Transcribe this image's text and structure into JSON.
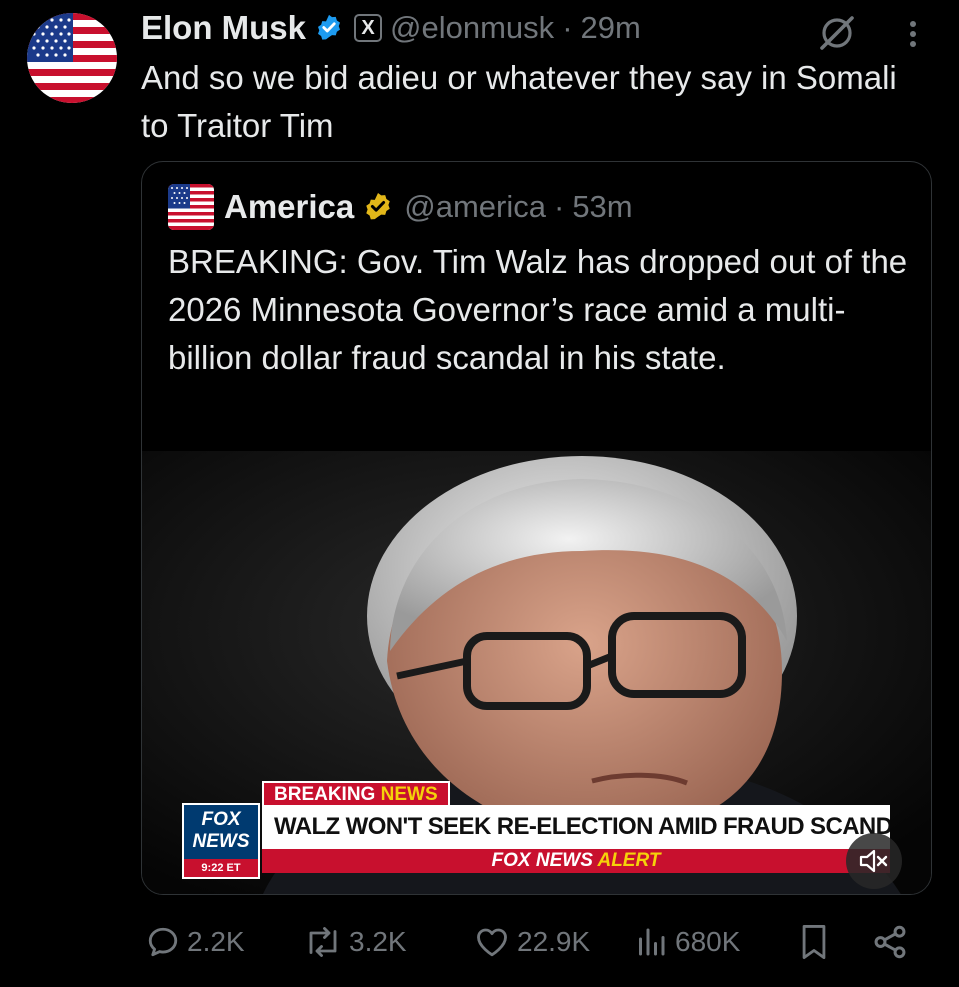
{
  "author": {
    "name": "Elon Musk",
    "handle": "@elonmusk",
    "separator": "·",
    "time": "29m",
    "avatar_icon": "us-flag-avatar",
    "badge_icon": "verified-blue-badge",
    "affiliation_icon": "x-affiliate-badge",
    "affiliation_label": "X"
  },
  "tweet_text": "And so we bid adieu or whatever they say in Somali to Traitor Tim",
  "quoted": {
    "name": "America",
    "handle": "@america",
    "separator": "·",
    "time": "53m",
    "avatar_icon": "us-flag-avatar",
    "badge_icon": "verified-gold-badge",
    "text": "BREAKING: Gov. Tim Walz has dropped out of the 2026 Minnesota Governor’s race amid a multi-billion dollar fraud scandal in his state.",
    "media": {
      "type": "video",
      "tag_left": "BREAKING",
      "tag_right": "NEWS",
      "headline": "WALZ WON'T SEEK RE-ELECTION AMID FRAUD SCANDAL",
      "alert_left": "FOX NEWS",
      "alert_right": "ALERT",
      "logo_top": "FOX",
      "logo_bottom": "NEWS",
      "clock": "9:22 ET",
      "mute_icon": "speaker-muted-icon"
    }
  },
  "actions": {
    "replies": "2.2K",
    "reposts": "3.2K",
    "likes": "22.9K",
    "views": "680K"
  },
  "colors": {
    "background": "#000000",
    "text": "#e7e9ea",
    "muted": "#71767b",
    "border": "#2f3336",
    "verified_blue": "#1d9bf0",
    "verified_gold": "#e2b719",
    "fox_red": "#c8102e",
    "fox_yellow": "#f5d20a",
    "fox_blue": "#003a70"
  }
}
